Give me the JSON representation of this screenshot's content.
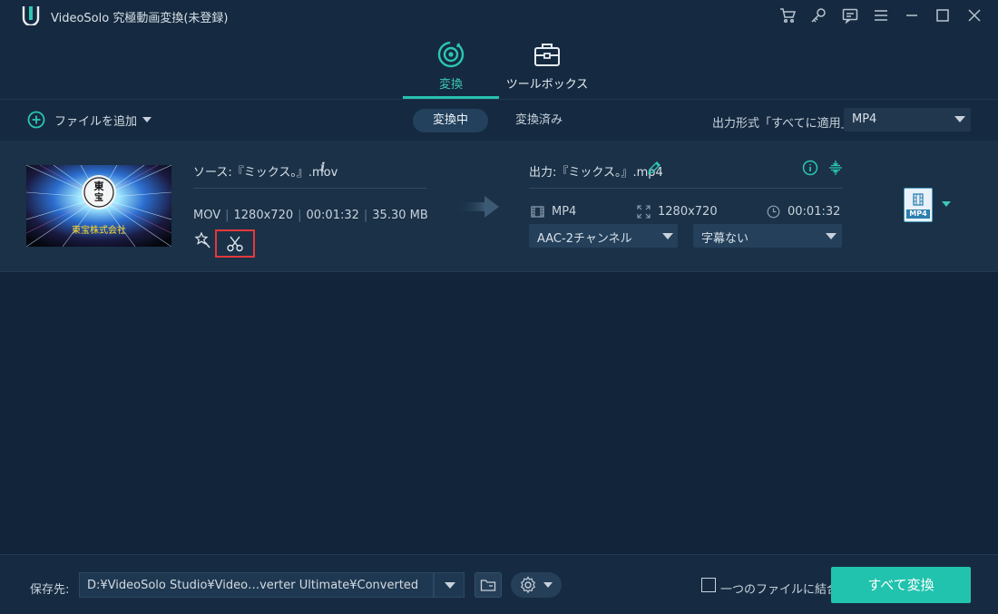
{
  "app": {
    "title": "VideoSolo 究極動画変換(未登録)"
  },
  "titlebar_buttons": [
    {
      "name": "cart-icon"
    },
    {
      "name": "key-icon"
    },
    {
      "name": "feedback-icon"
    },
    {
      "name": "menu-icon"
    },
    {
      "name": "minimize-icon"
    },
    {
      "name": "maximize-icon"
    },
    {
      "name": "close-icon"
    }
  ],
  "tabs": {
    "convert": "変換",
    "toolbox": "ツールボックス"
  },
  "toolbar": {
    "add_file": "ファイルを追加",
    "converting": "変換中",
    "converted": "変換済み",
    "output_format_label": "出力形式「すべてに適用」:",
    "output_format_value": "MP4"
  },
  "file": {
    "thumbnail_text": "東宝株式会社",
    "thumbnail_logo": "東宝",
    "source_name": "ソース:『ミックス。』.mov",
    "source_format": "MOV",
    "source_resolution": "1280x720",
    "source_duration": "00:01:32",
    "source_size": "35.30 MB",
    "output_name": "出力:『ミックス。』.mp4",
    "output_format": "MP4",
    "output_resolution": "1280x720",
    "output_duration": "00:01:32",
    "audio_track": "AAC-2チャンネル",
    "subtitle": "字幕ない",
    "format_badge": "MP4"
  },
  "bottom": {
    "save_label": "保存先:",
    "save_path": "D:¥VideoSolo Studio¥Video…verter Ultimate¥Converted",
    "merge_label": "一つのファイルに結合",
    "convert_all": "すべて変換"
  },
  "colors": {
    "accent": "#22c3ae",
    "background": "#11243a",
    "highlight_box": "#e5383b"
  }
}
